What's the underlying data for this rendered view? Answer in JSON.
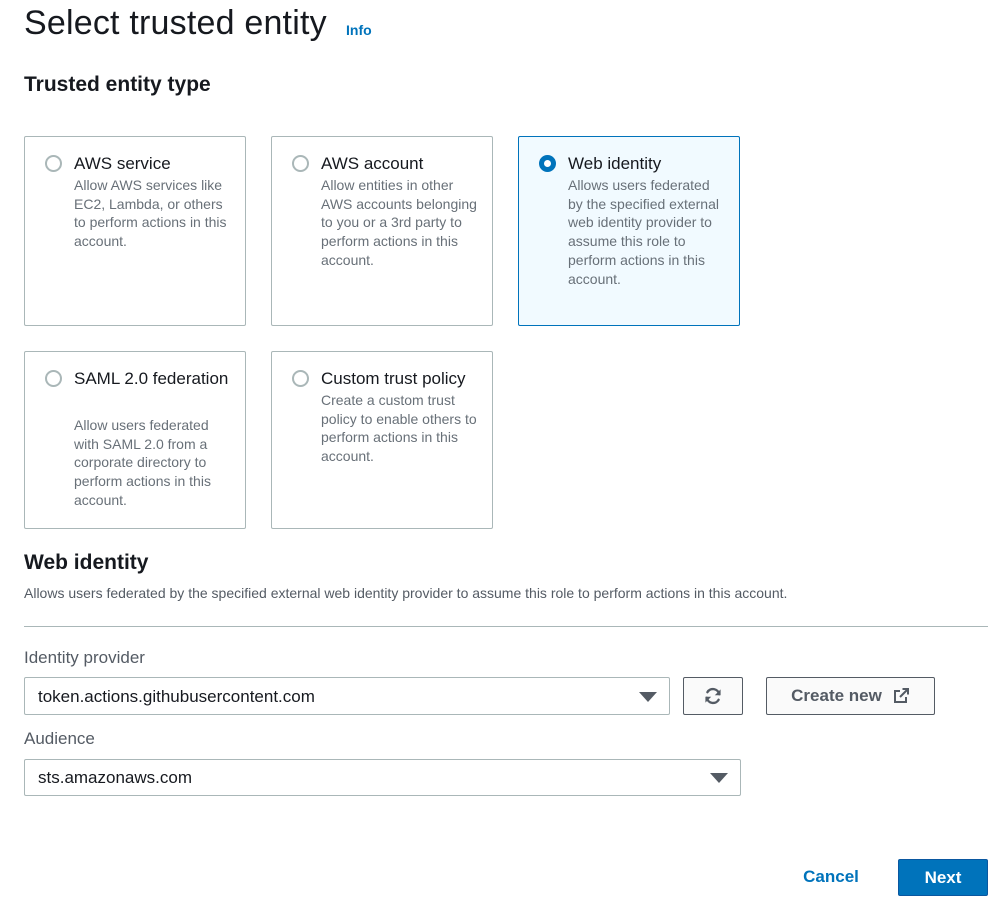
{
  "header": {
    "title": "Select trusted entity",
    "info_label": "Info"
  },
  "trusted_entity_type": {
    "heading": "Trusted entity type",
    "options": [
      {
        "title": "AWS service",
        "description": "Allow AWS services like EC2, Lambda, or others to perform actions in this account.",
        "selected": false
      },
      {
        "title": "AWS account",
        "description": "Allow entities in other AWS accounts belonging to you or a 3rd party to perform actions in this account.",
        "selected": false
      },
      {
        "title": "Web identity",
        "description": "Allows users federated by the specified external web identity provider to assume this role to perform actions in this account.",
        "selected": true
      },
      {
        "title": "SAML 2.0 federation",
        "description": "Allow users federated with SAML 2.0 from a corporate directory to perform actions in this account.",
        "selected": false
      },
      {
        "title": "Custom trust policy",
        "description": "Create a custom trust policy to enable others to perform actions in this account.",
        "selected": false
      }
    ]
  },
  "web_identity": {
    "heading": "Web identity",
    "description": "Allows users federated by the specified external web identity provider to assume this role to perform actions in this account.",
    "identity_provider": {
      "label": "Identity provider",
      "value": "token.actions.githubusercontent.com"
    },
    "create_new_label": "Create new",
    "audience": {
      "label": "Audience",
      "value": "sts.amazonaws.com"
    }
  },
  "footer": {
    "cancel_label": "Cancel",
    "next_label": "Next"
  },
  "colors": {
    "accent": "#0073bb",
    "selected_background": "#f1faff",
    "border": "#aab7b8"
  },
  "icons": [
    "radio-icon",
    "refresh-icon",
    "external-link-icon",
    "caret-down-icon"
  ]
}
